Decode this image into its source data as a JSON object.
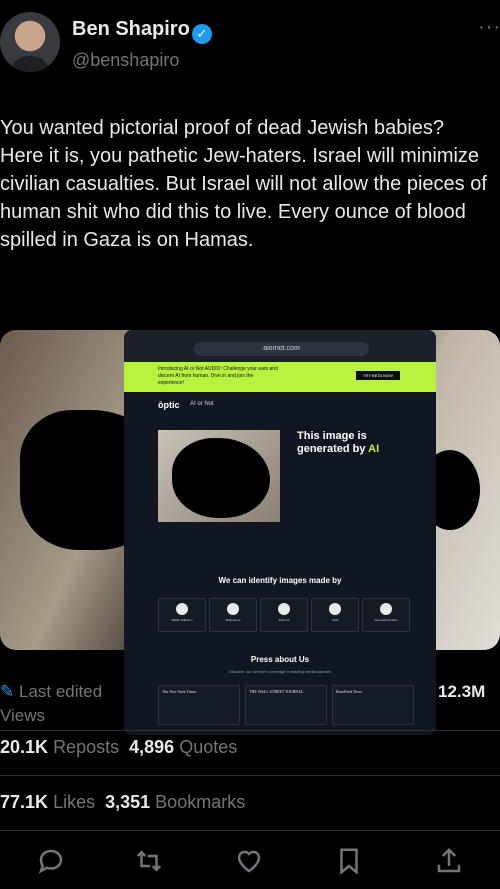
{
  "author": {
    "name": "Ben Shapiro",
    "handle": "@benshapiro",
    "verified_icon": "✓",
    "more_icon": "···"
  },
  "tweet": {
    "text": "You wanted pictorial proof of dead Jewish babies? Here it is, you pathetic Jew-haters. Israel will minimize civilian casualties. But Israel will not allow the pieces of human shit who did this to live. Every ounce of blood spilled in Gaza is on Hamas."
  },
  "embedded_screenshot": {
    "url": "aiornot.com",
    "banner_text": "Introducing AI or Not AUDIO: Challenge your ears and discern AI from human. Dive in and join the experience!",
    "banner_button": "TRY BETA NOW",
    "logo": "ōptic",
    "logo_sub": "AI or Not",
    "result_prefix": "This image is generated by ",
    "result_ai": "AI",
    "identify_heading": "We can identify images made by",
    "generators": [
      "Stable Diffusion",
      "Midjourney",
      "DALL-E",
      "GAN",
      "Generated Faces"
    ],
    "press_heading": "Press about Us",
    "press_sub": "Discover our service's coverage in leading media sources",
    "press_outlets": [
      "The New York Times",
      "THE WALL STREET JOURNAL",
      "BuzzFeed News"
    ]
  },
  "meta": {
    "last_edited": "Last edited",
    "views_count": "12.3M",
    "views_label": "Views",
    "reposts_count": "20.1K",
    "reposts_label": "Reposts",
    "quotes_count": "4,896",
    "quotes_label": "Quotes",
    "likes_count": "77.1K",
    "likes_label": "Likes",
    "bookmarks_count": "3,351",
    "bookmarks_label": "Bookmarks"
  },
  "colors": {
    "accent": "#1d9bf0",
    "muted": "#71767b",
    "text": "#e7e9ea",
    "lime": "#b6f23e"
  }
}
